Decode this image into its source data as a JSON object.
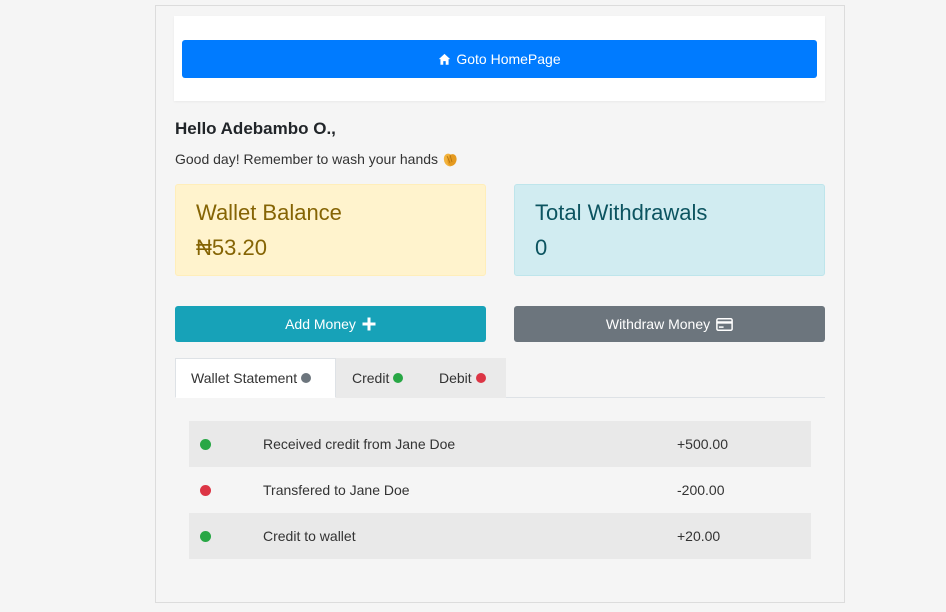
{
  "home": {
    "button_label": "Goto HomePage",
    "icon": "home-icon"
  },
  "greeting": {
    "title": "Hello Adebambo O.,",
    "message": "Good day! Remember to wash your hands",
    "icon": "clapping-hands-icon"
  },
  "cards": {
    "wallet": {
      "title": "Wallet Balance",
      "value": "₦53.20"
    },
    "withdrawals": {
      "title": "Total Withdrawals",
      "value": "0"
    }
  },
  "actions": {
    "add_money": {
      "label": "Add Money",
      "icon": "plus-icon"
    },
    "withdraw_money": {
      "label": "Withdraw Money",
      "icon": "credit-card-icon"
    }
  },
  "tabs": [
    {
      "label": "Wallet Statement",
      "dot_color": "#6c757d",
      "active": true
    },
    {
      "label": "Credit",
      "dot_color": "#28a745",
      "active": false
    },
    {
      "label": "Debit",
      "dot_color": "#dc3545",
      "active": false
    }
  ],
  "transactions": [
    {
      "description": "Received credit from Jane Doe",
      "amount": "+500.00",
      "type": "credit",
      "dot_color": "#28a745"
    },
    {
      "description": "Transfered to Jane Doe",
      "amount": "-200.00",
      "type": "debit",
      "dot_color": "#dc3545"
    },
    {
      "description": "Credit to wallet",
      "amount": "+20.00",
      "type": "credit",
      "dot_color": "#28a745"
    }
  ],
  "colors": {
    "primary": "#007bff",
    "info": "#17a2b8",
    "secondary": "#6c757d",
    "warning_bg": "#fff3cd",
    "warning_text": "#856404",
    "info_bg": "#d1ecf1",
    "info_text": "#0c5460"
  }
}
